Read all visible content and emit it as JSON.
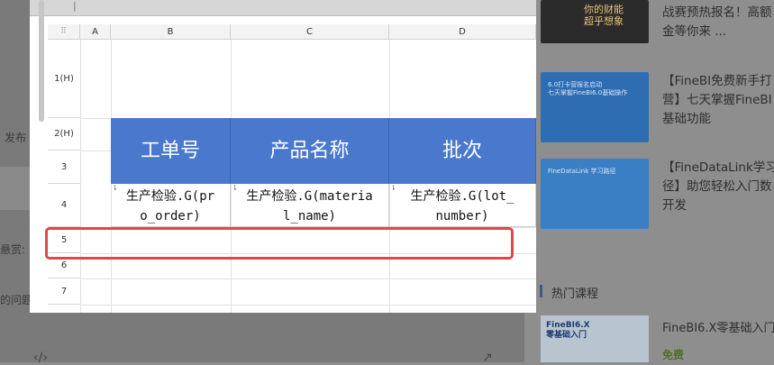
{
  "background": {
    "left_texts": [
      "发布",
      "悬赏:",
      "的问题"
    ],
    "bottom_icons": [
      "code-icon",
      "external-link-icon"
    ]
  },
  "sheet": {
    "corner_icon": "select-all-icon",
    "columns": [
      "A",
      "B",
      "C",
      "D"
    ],
    "rows": [
      "1(H)",
      "2(H)",
      "3",
      "4",
      "5",
      "6",
      "7"
    ],
    "header_cells": [
      "工单号",
      "产品名称",
      "批次"
    ],
    "formula_cells": [
      {
        "lines": [
          "生产检验.G(pr",
          "o_order)"
        ]
      },
      {
        "lines": [
          "生产检验.G(materia",
          "l_name)"
        ]
      },
      {
        "lines": [
          "生产检验.G(lot_",
          "number)"
        ]
      }
    ],
    "header_color": "#4a78cc",
    "highlight_color": "#e0474c",
    "highlighted_row": "5"
  },
  "sidebar": {
    "articles": [
      {
        "image_text": "你的财能\n超乎想象",
        "title": "战赛预热报名！高额\n金等你来 ..."
      },
      {
        "image_text": "6.0打卡营报名启动\n七天掌握FineBI6.0基础操作",
        "title": "【FineBI免费新手打\n营】七天掌握FineBI\n基础功能"
      },
      {
        "image_text": "FineDataLink 学习路径",
        "title": "【FineDataLink学习\n径】助您轻松入门数\n开发"
      }
    ],
    "section_title": "热门课程",
    "course": {
      "image_text": "FineBI6.X\n零基础入门",
      "name": "FineBI6.X零基础入门",
      "price": "免费"
    }
  }
}
